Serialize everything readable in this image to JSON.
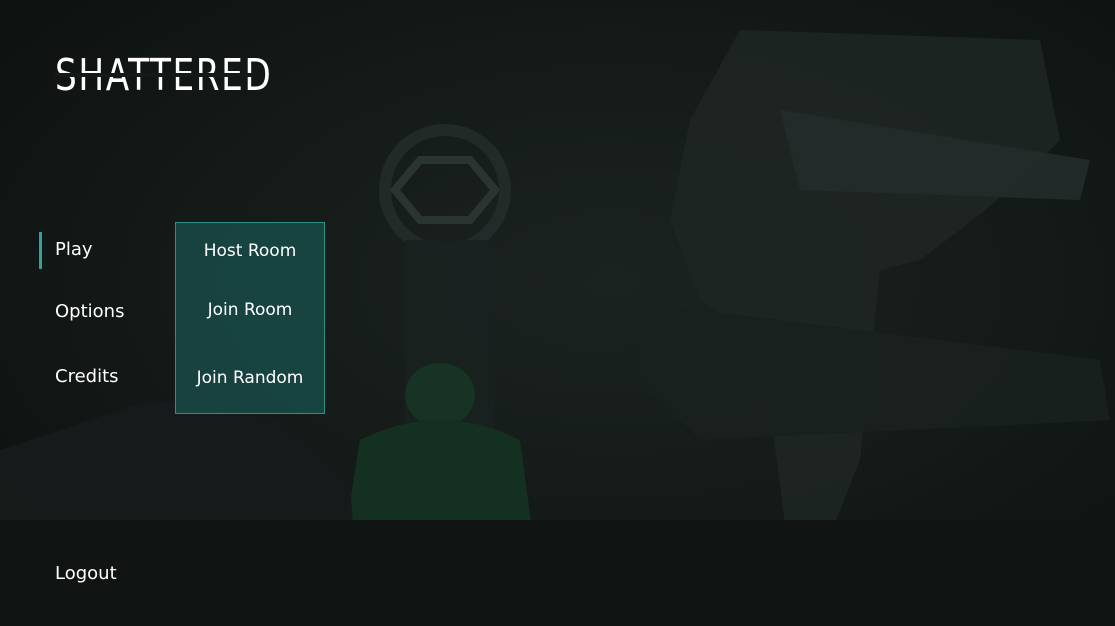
{
  "logo": {
    "text": "SHATTERED"
  },
  "menu": {
    "items": [
      {
        "id": "play",
        "label": "Play",
        "selected": true
      },
      {
        "id": "options",
        "label": "Options"
      },
      {
        "id": "credits",
        "label": "Credits"
      }
    ],
    "logout_label": "Logout"
  },
  "play_submenu": {
    "items": [
      {
        "id": "host",
        "label": "Host Room"
      },
      {
        "id": "join",
        "label": "Join Room"
      },
      {
        "id": "random",
        "label": "Join Random"
      }
    ]
  },
  "colors": {
    "accent": "#2fa39a",
    "panel": "#184e4b",
    "text": "#ffffff",
    "background": "#141a19"
  }
}
